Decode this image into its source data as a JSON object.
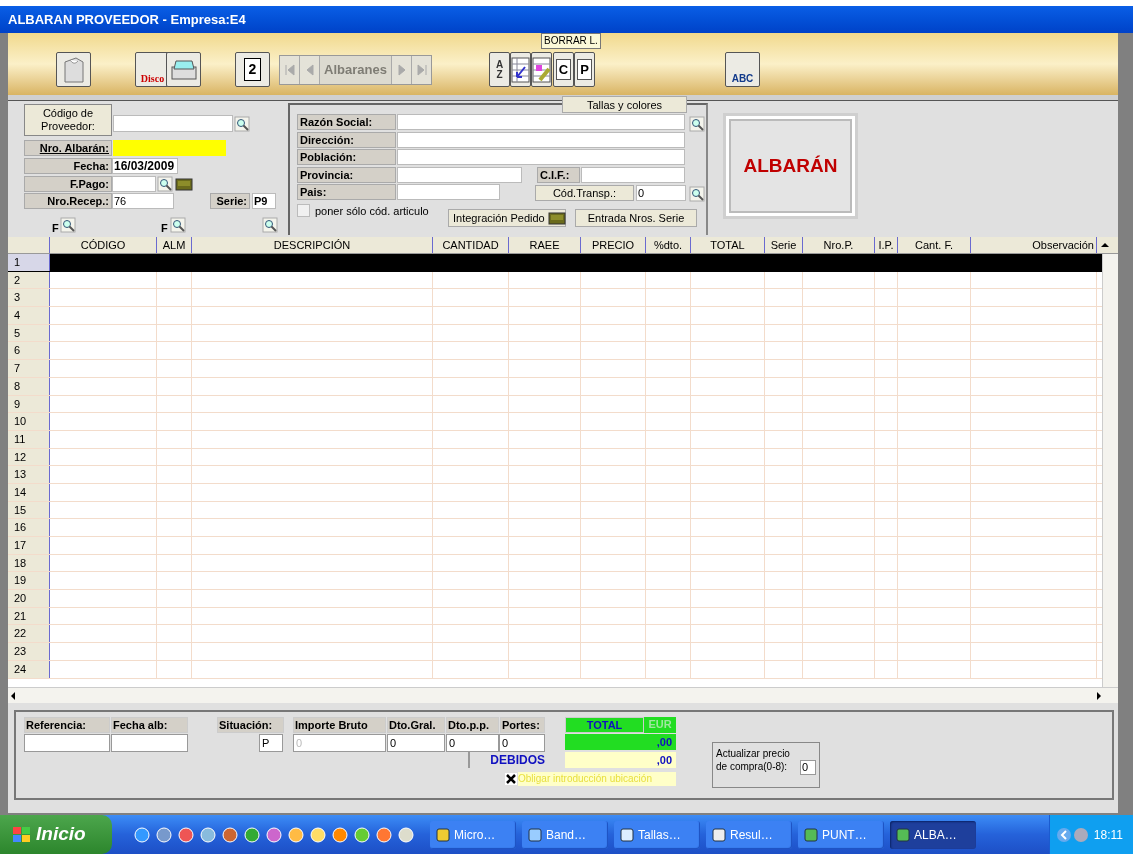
{
  "window": {
    "title": "ALBARAN PROVEEDOR - Empresa:E4"
  },
  "toolbar": {
    "tooltip": "BORRAR L.",
    "buttons": [
      {
        "kind": "new"
      },
      {
        "kind": "disk",
        "label": "Disco"
      },
      {
        "kind": "print"
      },
      {
        "kind": "page",
        "label": "2"
      },
      {
        "kind": "sort",
        "label": "AZ"
      },
      {
        "kind": "grid"
      },
      {
        "kind": "edit"
      },
      {
        "kind": "doc",
        "label": "C"
      },
      {
        "kind": "doc",
        "label": "P"
      },
      {
        "kind": "spell",
        "label": "ABC"
      }
    ],
    "navigator": {
      "label": "Albaranes",
      "disabled": true
    }
  },
  "header": {
    "fields": [
      {
        "label": "Código de Proveedor:"
      },
      {
        "label": "Nro. Albarán:"
      },
      {
        "label": "Fecha:",
        "value": "16/03/2009"
      },
      {
        "label": "F.Pago:"
      },
      {
        "label": "Nro.Recep.:",
        "value": "76"
      },
      {
        "label": "Serie:",
        "value": "P9"
      }
    ],
    "filters": [
      "F",
      "F"
    ]
  },
  "customer": {
    "sizes_button": "Tallas y colores",
    "fields": [
      {
        "label": "Razón Social:"
      },
      {
        "label": "Dirección:"
      },
      {
        "label": "Población:"
      },
      {
        "label": "Provincia:"
      },
      {
        "label": "C.I.F.:"
      },
      {
        "label": "Pais:"
      },
      {
        "label": "Cód.Transp.:",
        "value": "0"
      }
    ],
    "only_code": {
      "label": "poner sólo cód. articulo",
      "checked": false
    },
    "buttons": [
      "Integración Pedido",
      "Entrada Nros. Serie"
    ]
  },
  "doc_type": "ALBARÁN",
  "grid": {
    "columns": [
      "CÓDIGO",
      "ALM",
      "DESCRIPCIÓN",
      "CANTIDAD",
      "RAEE",
      "PRECIO",
      "%dto.",
      "TOTAL",
      "Serie",
      "Nro.P.",
      "I.P.",
      "Cant. F.",
      "Observación"
    ],
    "rows": [
      {
        "number": "1",
        "selected": true
      },
      {
        "number": "2",
        "selected": false
      },
      {
        "number": "3",
        "selected": false
      },
      {
        "number": "4",
        "selected": false
      },
      {
        "number": "5",
        "selected": false
      },
      {
        "number": "6",
        "selected": false
      },
      {
        "number": "7",
        "selected": false
      },
      {
        "number": "8",
        "selected": false
      },
      {
        "number": "9",
        "selected": false
      },
      {
        "number": "10",
        "selected": false
      },
      {
        "number": "11",
        "selected": false
      },
      {
        "number": "12",
        "selected": false
      },
      {
        "number": "13",
        "selected": false
      },
      {
        "number": "14",
        "selected": false
      },
      {
        "number": "15",
        "selected": false
      },
      {
        "number": "16",
        "selected": false
      },
      {
        "number": "17",
        "selected": false
      },
      {
        "number": "18",
        "selected": false
      },
      {
        "number": "19",
        "selected": false
      },
      {
        "number": "20",
        "selected": false
      },
      {
        "number": "21",
        "selected": false
      },
      {
        "number": "22",
        "selected": false
      },
      {
        "number": "23",
        "selected": false
      },
      {
        "number": "24",
        "selected": false
      }
    ]
  },
  "footer": {
    "fields": [
      {
        "label": "Referencia:"
      },
      {
        "label": "Fecha alb:"
      },
      {
        "label": "Situación:",
        "value": "P"
      },
      {
        "label": "Importe Bruto",
        "value": "0",
        "disabled": true
      },
      {
        "label": "Dto.Gral.",
        "value": "0",
        "disabled": false
      },
      {
        "label": "Dto.p.p.",
        "value": "0",
        "disabled": false
      },
      {
        "label": "Portes:",
        "value": "0",
        "disabled": false
      }
    ],
    "total": {
      "label": "TOTAL",
      "currency": "EUR",
      "value": ",00"
    },
    "debidos": {
      "label": "DEBIDOS",
      "value": ",00"
    },
    "force_location": {
      "label": "Obligar introducción ubicación",
      "checked": true
    },
    "update_price": {
      "label": "Actualizar precio de compra(0-8):",
      "value": "0"
    }
  },
  "taskbar": {
    "start": "Inicio",
    "tasks": [
      {
        "label": "Micro…",
        "selected": false
      },
      {
        "label": "Band…",
        "selected": false
      },
      {
        "label": "Tallas…",
        "selected": false
      },
      {
        "label": "Resul…",
        "selected": false
      },
      {
        "label": "PUNT…",
        "selected": false
      },
      {
        "label": "ALBA…",
        "selected": true
      }
    ],
    "clock": "18:11"
  }
}
